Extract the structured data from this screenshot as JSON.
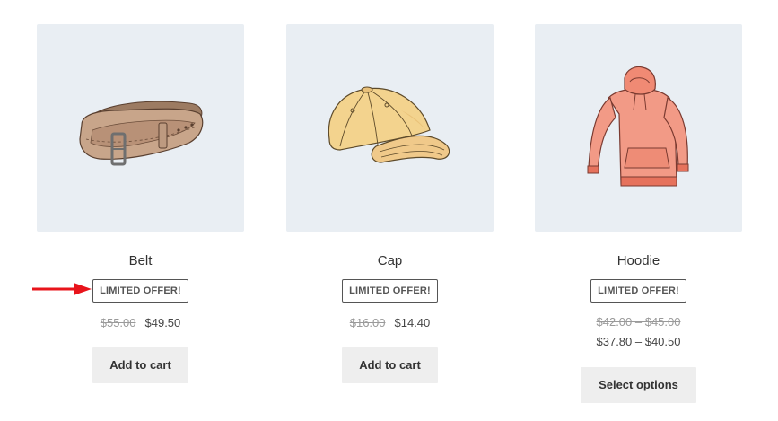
{
  "products": [
    {
      "name": "Belt",
      "badge": "LIMITED OFFER!",
      "price_old": "$55.00",
      "price_new": "$49.50",
      "button": "Add to cart",
      "image_icon": "belt-image"
    },
    {
      "name": "Cap",
      "badge": "LIMITED OFFER!",
      "price_old": "$16.00",
      "price_new": "$14.40",
      "button": "Add to cart",
      "image_icon": "cap-image"
    },
    {
      "name": "Hoodie",
      "badge": "LIMITED OFFER!",
      "price_old": "$42.00 – $45.00",
      "price_new": "$37.80 – $40.50",
      "button": "Select options",
      "image_icon": "hoodie-image"
    }
  ],
  "colors": {
    "thumb_bg": "#e9eef3",
    "button_bg": "#eeeeee",
    "arrow": "#e8141b",
    "badge_border": "#555555"
  },
  "annotation": {
    "icon": "red-arrow-icon"
  }
}
